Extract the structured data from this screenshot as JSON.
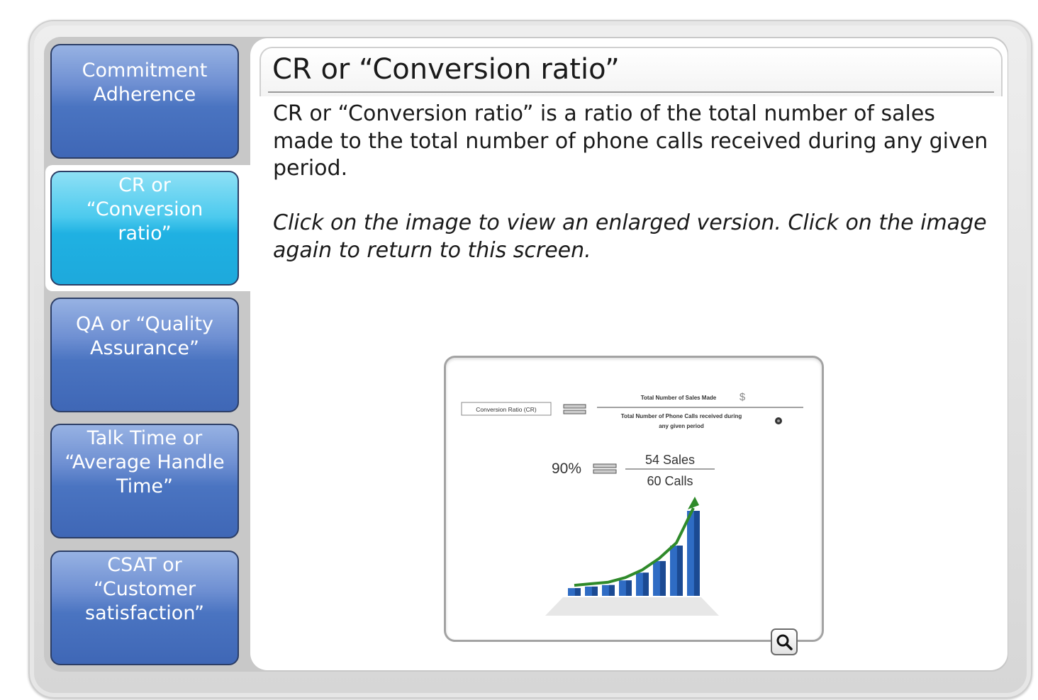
{
  "nav": {
    "items": [
      {
        "label": "Commitment Adherence",
        "active": false
      },
      {
        "label": "CR or “Conversion ratio”",
        "active": true
      },
      {
        "label": "QA or “Quality Assurance”",
        "active": false
      },
      {
        "label": "Talk Time or “Average Handle Time”",
        "active": false
      },
      {
        "label": "CSAT or “Customer satisfaction”",
        "active": false
      }
    ]
  },
  "main": {
    "title": "CR or “Conversion ratio”",
    "description": "CR or “Conversion ratio” is a ratio of the total number of sales made to the total number of phone calls received during any given period.",
    "instruction": "Click on the image to view an enlarged version. Click on the image again to return to this screen."
  },
  "figure": {
    "formula_label": "Conversion Ratio (CR)",
    "numerator": "Total Number of Sales Made",
    "denominator_line1": "Total Number of Phone Calls received during",
    "denominator_line2": "any given period",
    "example_result": "90%",
    "example_numerator": "54 Sales",
    "example_denominator": "60 Calls"
  },
  "chart_data": {
    "type": "bar",
    "values": [
      1,
      1.2,
      1.4,
      2,
      3,
      4.5,
      6.5,
      11
    ]
  },
  "icons": {
    "zoom": "magnifier-icon",
    "phone": "phone-icon",
    "money": "dollar-icon"
  },
  "colors": {
    "nav_tab": "#4a74c1",
    "nav_tab_active": "#1fb1e2",
    "bar": "#2f6cc4",
    "arrow": "#2f8a2a"
  }
}
